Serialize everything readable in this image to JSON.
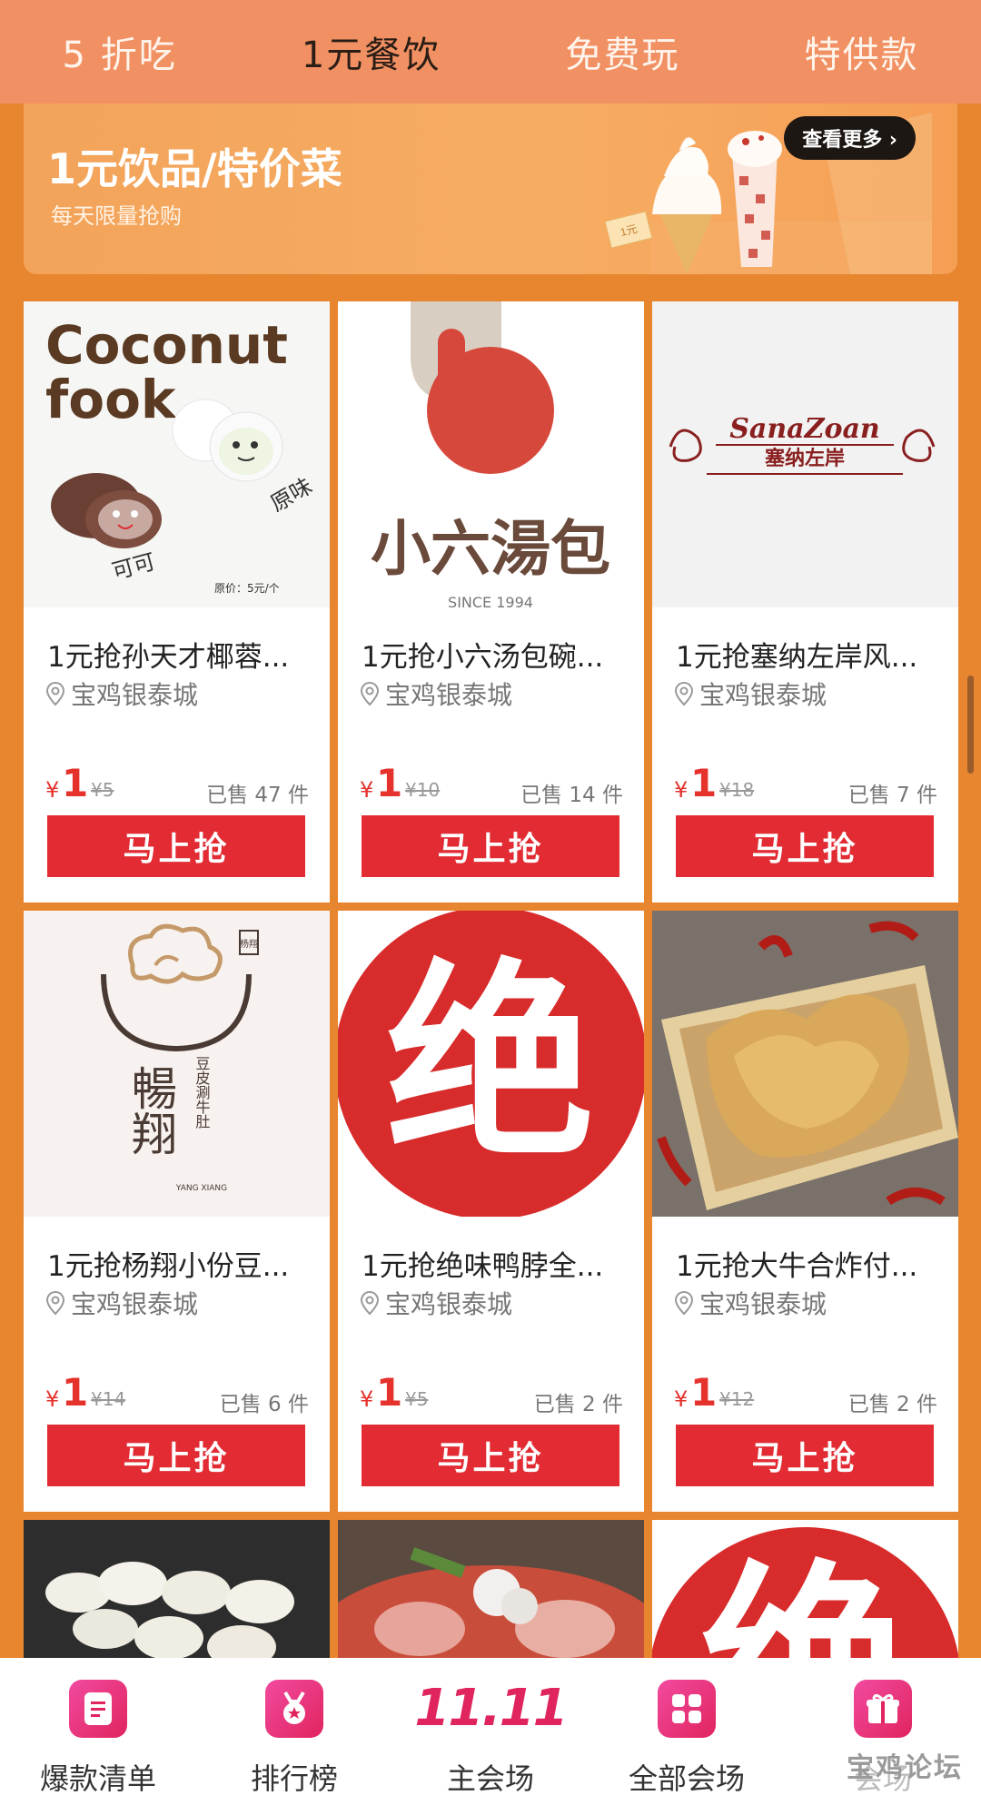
{
  "top_tabs": [
    {
      "label": "5 折吃",
      "active": false
    },
    {
      "label": "1元餐饮",
      "active": true
    },
    {
      "label": "免费玩",
      "active": false
    },
    {
      "label": "特供款",
      "active": false
    }
  ],
  "banner": {
    "title": "1元饮品/特价菜",
    "subtitle": "每天限量抢购",
    "more_label": "查看更多 ›",
    "tag_label": "1元"
  },
  "products": [
    {
      "name": "1元抢孙天才椰蓉...",
      "location": "宝鸡银泰城",
      "currency": "¥",
      "price": "1",
      "original": "¥5",
      "sold": "已售 47 件",
      "buy_label": "马上抢",
      "image": {
        "title_line1": "Coconut",
        "title_line2": "fook",
        "label_a": "原味",
        "label_b": "可可",
        "note": "原价：5元/个"
      }
    },
    {
      "name": "1元抢小六汤包碗...",
      "location": "宝鸡银泰城",
      "currency": "¥",
      "price": "1",
      "original": "¥10",
      "sold": "已售 14 件",
      "buy_label": "马上抢",
      "image": {
        "brand": "小六湯包",
        "since": "SINCE 1994"
      }
    },
    {
      "name": "1元抢塞纳左岸风...",
      "location": "宝鸡银泰城",
      "currency": "¥",
      "price": "1",
      "original": "¥18",
      "sold": "已售 7 件",
      "buy_label": "马上抢",
      "image": {
        "brand_en": "SanaZoan",
        "brand_cn": "塞纳左岸"
      }
    },
    {
      "name": "1元抢杨翔小份豆...",
      "location": "宝鸡银泰城",
      "currency": "¥",
      "price": "1",
      "original": "¥14",
      "sold": "已售 6 件",
      "buy_label": "马上抢",
      "image": {
        "brand": "暢翔",
        "desc": "豆皮涮牛肚",
        "en": "YANG XIANG",
        "seal": "杨翔"
      }
    },
    {
      "name": "1元抢绝味鸭脖全...",
      "location": "宝鸡银泰城",
      "currency": "¥",
      "price": "1",
      "original": "¥5",
      "sold": "已售 2 件",
      "buy_label": "马上抢",
      "image": {
        "brand": "绝"
      }
    },
    {
      "name": "1元抢大牛合炸付...",
      "location": "宝鸡银泰城",
      "currency": "¥",
      "price": "1",
      "original": "¥12",
      "sold": "已售 2 件",
      "buy_label": "马上抢",
      "image": {}
    }
  ],
  "partial_row": [
    {
      "kind": "potato"
    },
    {
      "kind": "hotpot"
    },
    {
      "kind": "jue",
      "brand": "绝"
    }
  ],
  "bottom_nav": [
    {
      "label": "爆款清单",
      "icon": "list-icon"
    },
    {
      "label": "排行榜",
      "icon": "medal-icon"
    },
    {
      "label": "主会场",
      "icon": "1111-logo",
      "logo_text": "11.11"
    },
    {
      "label": "全部会场",
      "icon": "grid-icon"
    },
    {
      "label": "会场",
      "icon": "gift-icon"
    }
  ],
  "watermark": "宝鸡论坛",
  "colors": {
    "accent": "#e22b33",
    "topbar": "#f19062",
    "background": "#e8852f",
    "nav_icon": "#e0245e"
  }
}
